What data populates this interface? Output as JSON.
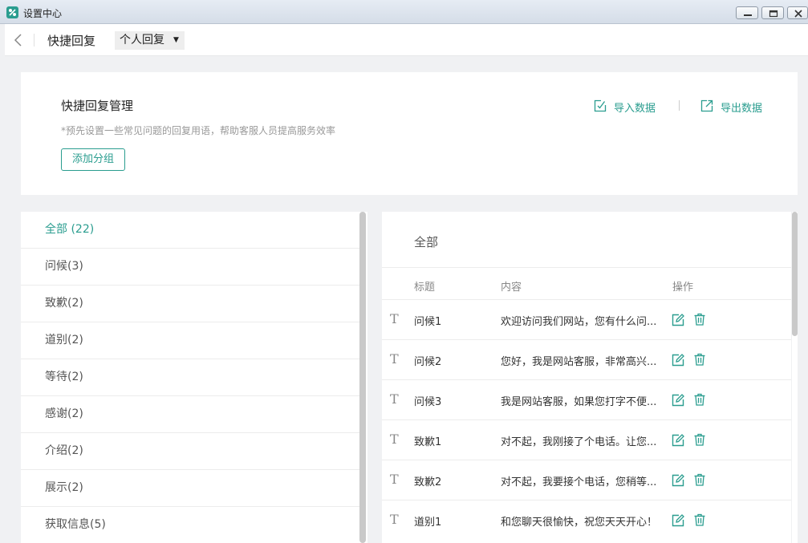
{
  "window": {
    "title": "设置中心",
    "accent": "#2a9d8f"
  },
  "header": {
    "back_icon": "chevron-left-icon",
    "title": "快捷回复",
    "scope_select": {
      "value": "个人回复",
      "caret": "▼"
    }
  },
  "manage": {
    "title": "快捷回复管理",
    "description": "*预先设置一些常见问题的回复用语，帮助客服人员提高服务效率",
    "add_group_label": "添加分组",
    "import_label": "导入数据",
    "export_label": "导出数据"
  },
  "groups": [
    {
      "label": "全部 (22)",
      "active": true
    },
    {
      "label": "问候(3)"
    },
    {
      "label": "致歉(2)"
    },
    {
      "label": "道别(2)"
    },
    {
      "label": "等待(2)"
    },
    {
      "label": "感谢(2)"
    },
    {
      "label": "介绍(2)"
    },
    {
      "label": "展示(2)"
    },
    {
      "label": "获取信息(5)"
    }
  ],
  "table": {
    "title": "全部",
    "columns": {
      "title": "标题",
      "content": "内容",
      "actions": "操作"
    },
    "rows": [
      {
        "icon": "T",
        "title": "问候1",
        "content": "欢迎访问我们网站，您有什么问..."
      },
      {
        "icon": "T",
        "title": "问候2",
        "content": "您好，我是网站客服，非常高兴..."
      },
      {
        "icon": "T",
        "title": "问候3",
        "content": "我是网站客服，如果您打字不便..."
      },
      {
        "icon": "T",
        "title": "致歉1",
        "content": "对不起，我刚接了个电话。让您..."
      },
      {
        "icon": "T",
        "title": "致歉2",
        "content": "对不起，我要接个电话，您稍等..."
      },
      {
        "icon": "T",
        "title": "道别1",
        "content": "和您聊天很愉快，祝您天天开心！"
      }
    ]
  }
}
